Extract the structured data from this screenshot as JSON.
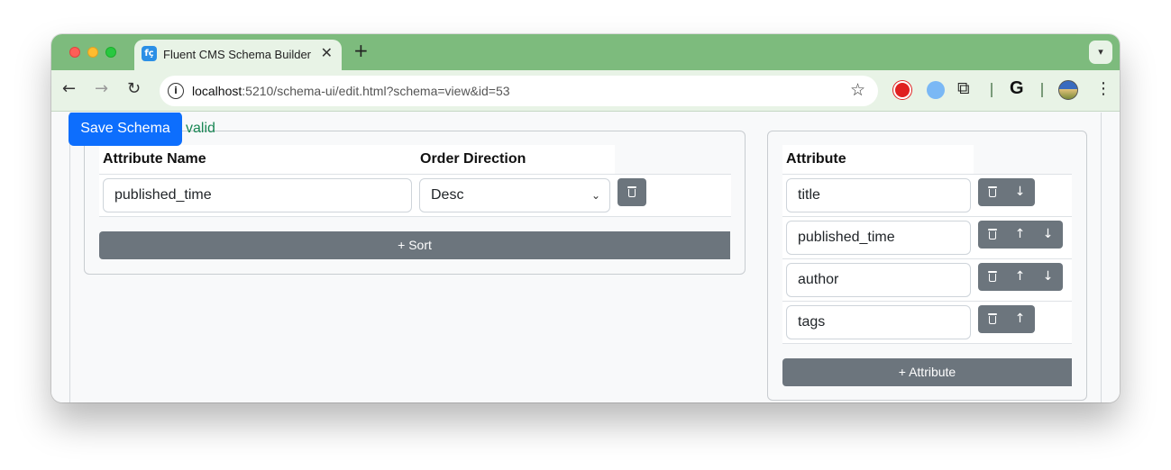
{
  "browser": {
    "tab_title": "Fluent CMS Schema Builder",
    "tab_favicon_text": "fç",
    "url_host": "localhost",
    "url_rest": ":5210/schema-ui/edit.html?schema=view&id=53",
    "icons": {
      "close": "close-icon",
      "new_tab": "plus-icon",
      "back": "arrow-left-icon",
      "forward": "arrow-right-icon",
      "reload": "reload-icon",
      "info": "info-icon",
      "bookmark": "star-icon",
      "extensions": "puzzle-icon",
      "menu": "kebab-menu-icon",
      "google": "G"
    }
  },
  "page": {
    "save_label": "Save Schema",
    "status": "valid",
    "sort": {
      "headers": [
        "Attribute Name",
        "Order Direction"
      ],
      "rows": [
        {
          "attribute": "published_time",
          "direction": "Desc"
        }
      ],
      "add_label": "+ Sort"
    },
    "attributes": {
      "header": "Attribute",
      "rows": [
        {
          "value": "title"
        },
        {
          "value": "published_time"
        },
        {
          "value": "author"
        },
        {
          "value": "tags"
        }
      ],
      "add_label": "+ Attribute"
    }
  },
  "colors": {
    "tabstrip": "#7dbb7d",
    "toolbar": "#e8f3e6",
    "primary": "#0d6efd",
    "secondary": "#6c757d",
    "success": "#198754"
  }
}
